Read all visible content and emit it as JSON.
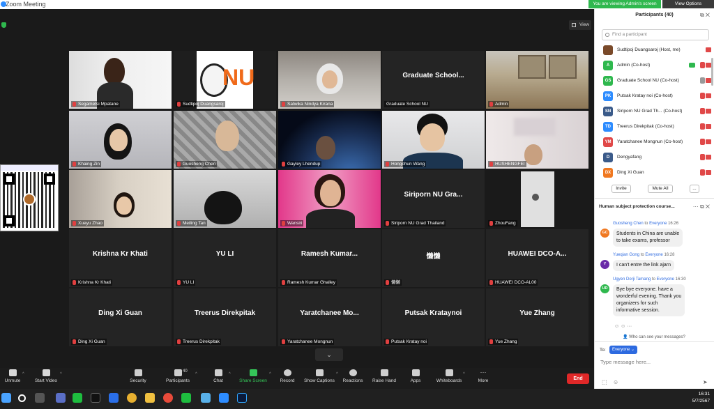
{
  "window": {
    "title": "Zoom Meeting",
    "viewing_banner": "You are viewing Admin's screen",
    "view_options": "View Options",
    "view_label": "View"
  },
  "tiles": [
    {
      "name": "Segametsi Mpatane",
      "big": ""
    },
    {
      "name": "Sudtipoj Duangsaroj",
      "big": ""
    },
    {
      "name": "Satwika Nindya Kirana",
      "big": ""
    },
    {
      "name": "Graduate School NU",
      "big": "Graduate School..."
    },
    {
      "name": "Admin",
      "big": ""
    },
    {
      "name": "Khaing Zin",
      "big": ""
    },
    {
      "name": "Guosheng Chen",
      "big": ""
    },
    {
      "name": "Gayley Lhendup",
      "big": ""
    },
    {
      "name": "Hongchun Wang",
      "big": ""
    },
    {
      "name": "HUSHENGFEI",
      "big": ""
    },
    {
      "name": "Xueyu Zhao",
      "big": ""
    },
    {
      "name": "Meiling Tan",
      "big": ""
    },
    {
      "name": "Wansiri",
      "big": ""
    },
    {
      "name": "Siriporn NU Grad Thailand",
      "big": "Siriporn NU Gra..."
    },
    {
      "name": "ZhouFang",
      "big": ""
    },
    {
      "name": "Krishna Kr Khati",
      "big": "Krishna Kr Khati"
    },
    {
      "name": "YU LI",
      "big": "YU LI"
    },
    {
      "name": "Ramesh Kumar Ghalley",
      "big": "Ramesh  Kumar..."
    },
    {
      "name": "懒懒",
      "big": "懒懒"
    },
    {
      "name": "HUAWEI DCO-AL00",
      "big": "HUAWEI DCO-A..."
    },
    {
      "name": "Ding Xi Guan",
      "big": "Ding Xi Guan"
    },
    {
      "name": "Treerus Direkpitak",
      "big": "Treerus Direkpitak"
    },
    {
      "name": "Yaratchanee Mongnun",
      "big": "Yaratchanee  Mo..."
    },
    {
      "name": "Putsak Kratay noi",
      "big": "Putsak Krataynoi"
    },
    {
      "name": "Yue  Zhang",
      "big": "Yue  Zhang"
    }
  ],
  "toolbar": {
    "unmute": "Unmute",
    "start_video": "Start Video",
    "security": "Security",
    "participants": "Participants",
    "participants_count": "40",
    "chat": "Chat",
    "share_screen": "Share Screen",
    "record": "Record",
    "show_captions": "Show Captions",
    "reactions": "Reactions",
    "raise_hand": "Raise Hand",
    "apps": "Apps",
    "whiteboards": "Whiteboards",
    "more": "More",
    "end": "End"
  },
  "participants_panel": {
    "title": "Participants (40)",
    "search_placeholder": "Find a participant",
    "invite": "Invite",
    "mute_all": "Mute All",
    "more": "...",
    "list": [
      {
        "initials": "",
        "name": "Sudtipoj Duangsaroj (Host, me)",
        "color": "#7a4a2a"
      },
      {
        "initials": "A",
        "name": "Admin (Co-host)",
        "color": "#2fb84e"
      },
      {
        "initials": "GS",
        "name": "Graduate School NU (Co-host)",
        "color": "#2fb84e"
      },
      {
        "initials": "PK",
        "name": "Putsak Kratay noi (Co-host)",
        "color": "#2d8cff"
      },
      {
        "initials": "SN",
        "name": "Siriporn NU Grad Th...  (Co-host)",
        "color": "#3b5b8a"
      },
      {
        "initials": "TD",
        "name": "Treerus Direkpitak (Co-host)",
        "color": "#2d8cff"
      },
      {
        "initials": "YM",
        "name": "Yaratchanee Mongnun (Co-host)",
        "color": "#e04848"
      },
      {
        "initials": "D",
        "name": "Dengyafang",
        "color": "#3b5b8a"
      },
      {
        "initials": "DX",
        "name": "Ding Xi Guan",
        "color": "#f07820"
      }
    ]
  },
  "chat_panel": {
    "title": "Human subject protection course...",
    "messages": [
      {
        "initials": "GC",
        "color": "#f07820",
        "from": "Guosheng Chen",
        "to": "to",
        "target": "Everyone",
        "time": "16:26",
        "lines": [
          "Students in China are unable",
          "to take exams, professor"
        ]
      },
      {
        "initials": "Y",
        "color": "#6a2aa8",
        "from": "Yueqian Gong",
        "to": "to",
        "target": "Everyone",
        "time": "16:28",
        "lines": [
          "I can't entre the link ajarn"
        ]
      },
      {
        "initials": "UD",
        "color": "#2fb84e",
        "from": "Ugyen Dorji Tamang",
        "to": "to",
        "target": "Everyone",
        "time": "16:30",
        "lines": [
          "Bye bye everyone. have a",
          "wonderful evening. Thank you",
          "organizers for such",
          "informative session."
        ]
      }
    ],
    "who_can_see": "Who can see your messages?",
    "to_label": "To:",
    "to_value": "Everyone",
    "input_placeholder": "Type message here..."
  },
  "taskbar": {
    "time": "16:31",
    "date": "5/7/2567"
  }
}
